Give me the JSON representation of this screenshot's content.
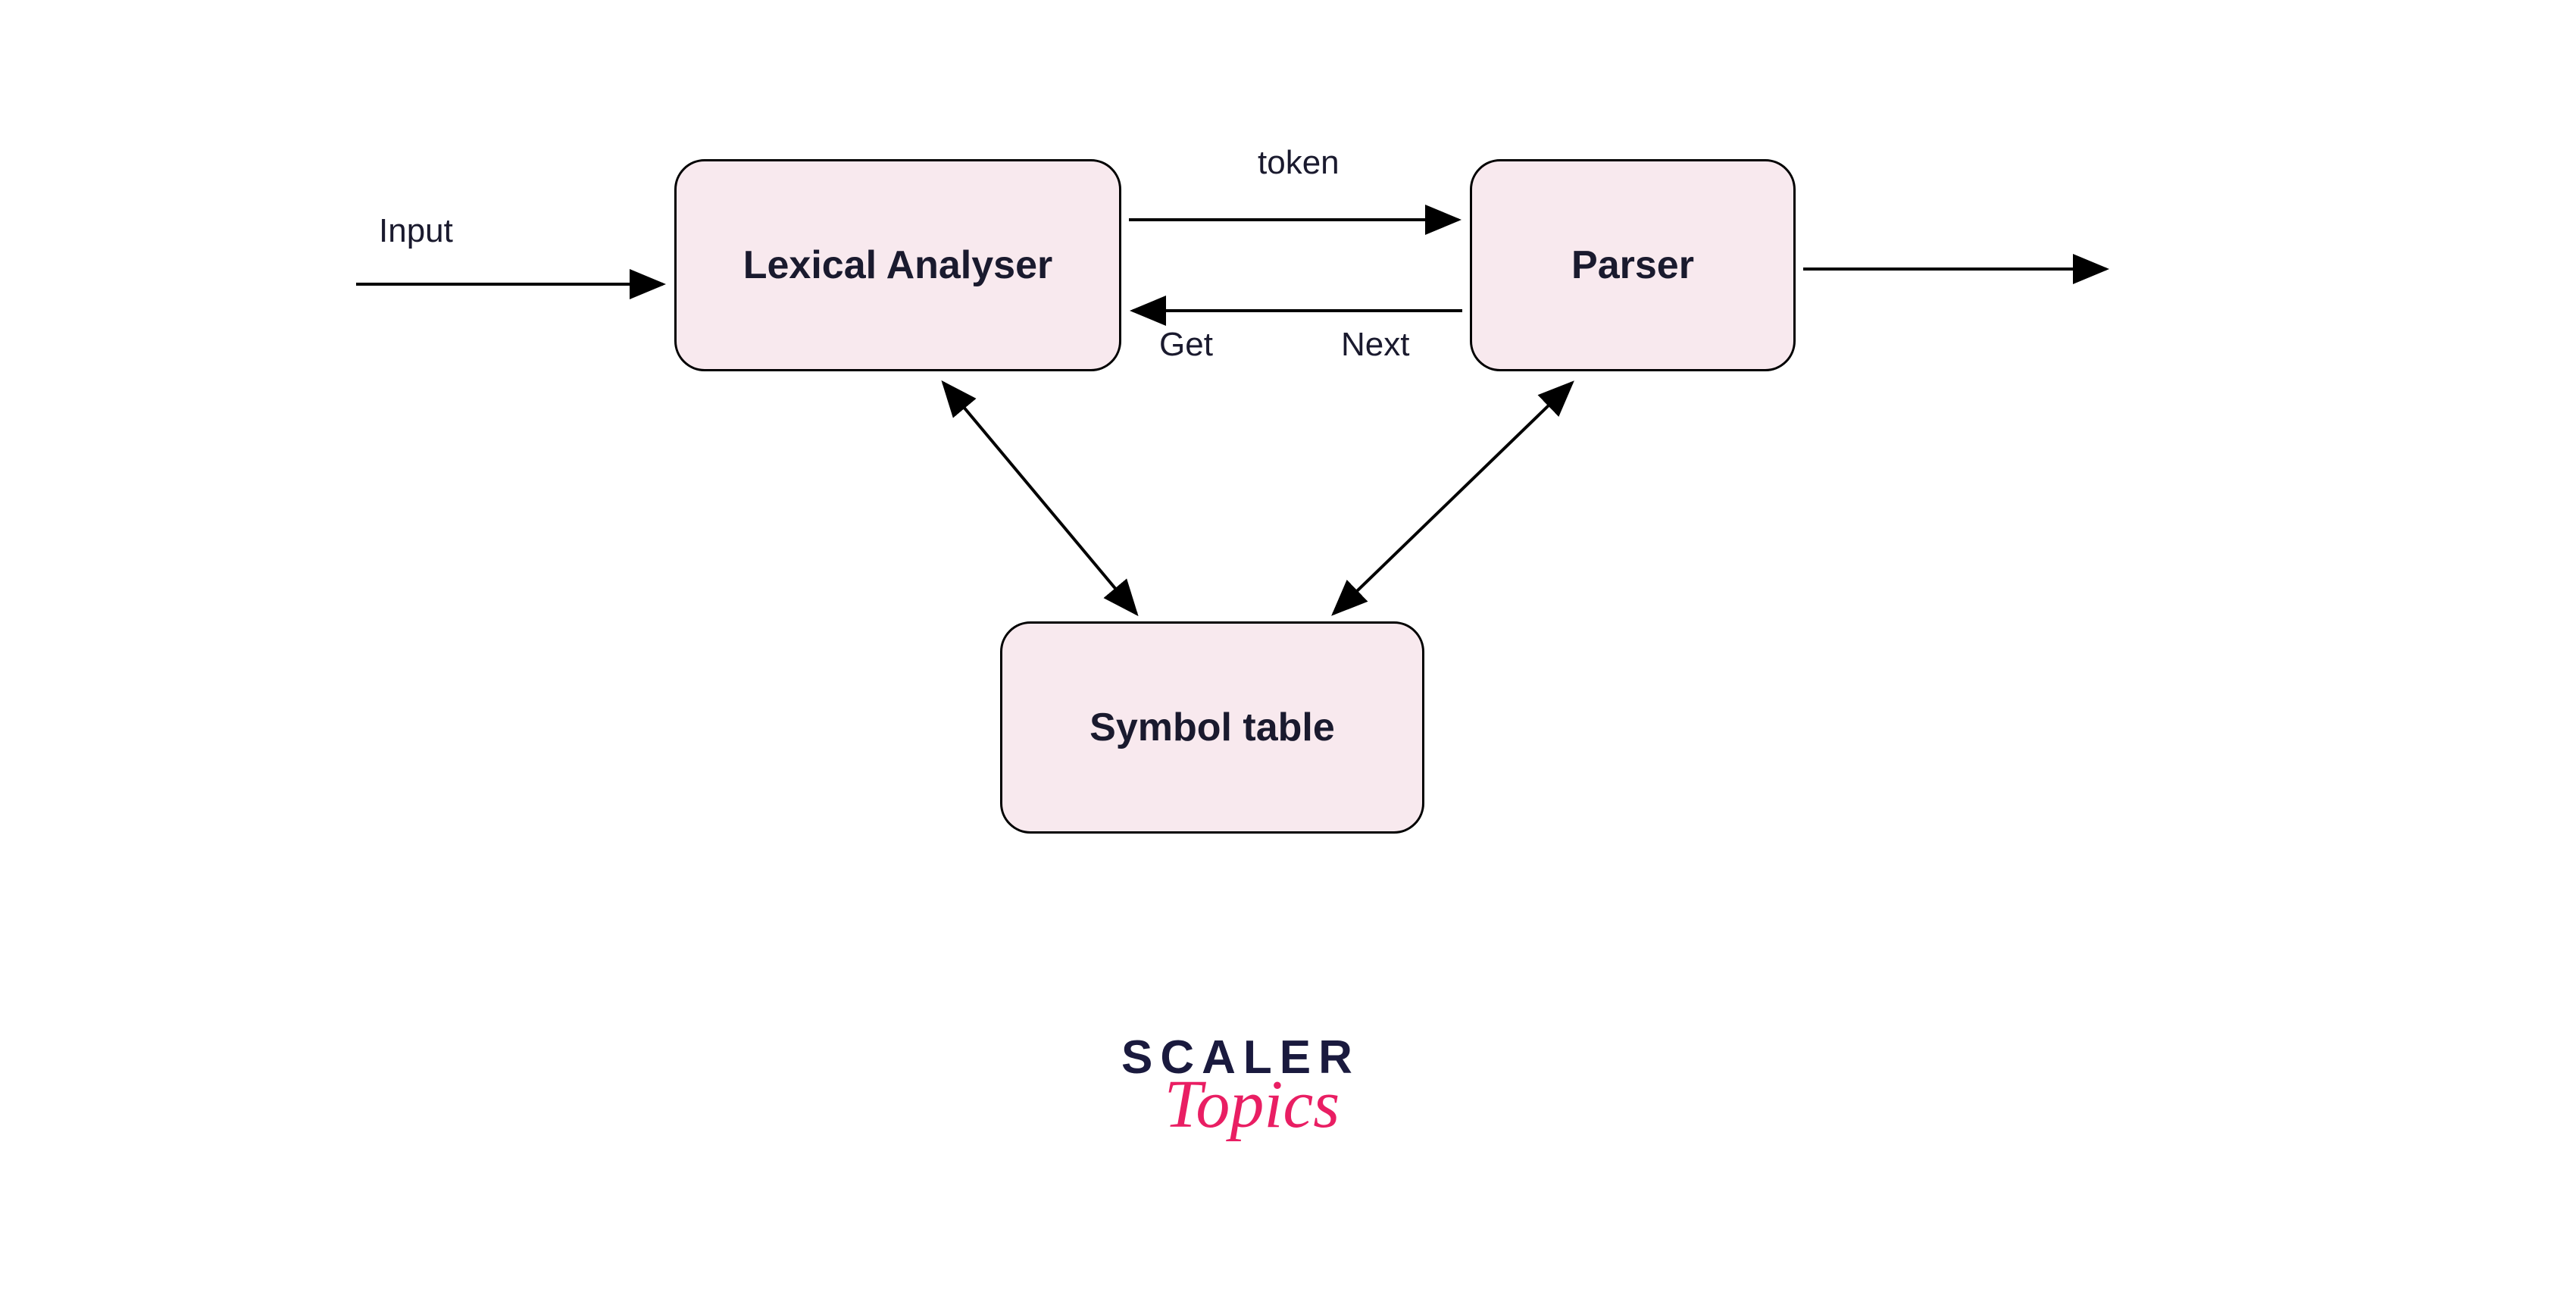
{
  "diagram": {
    "boxes": {
      "lexical": "Lexical Analyser",
      "parser": "Parser",
      "symbol": "Symbol table"
    },
    "labels": {
      "input": "Input",
      "token": "token",
      "get": "Get",
      "next": "Next"
    }
  },
  "logo": {
    "main": "SCALER",
    "sub": "Topics"
  }
}
